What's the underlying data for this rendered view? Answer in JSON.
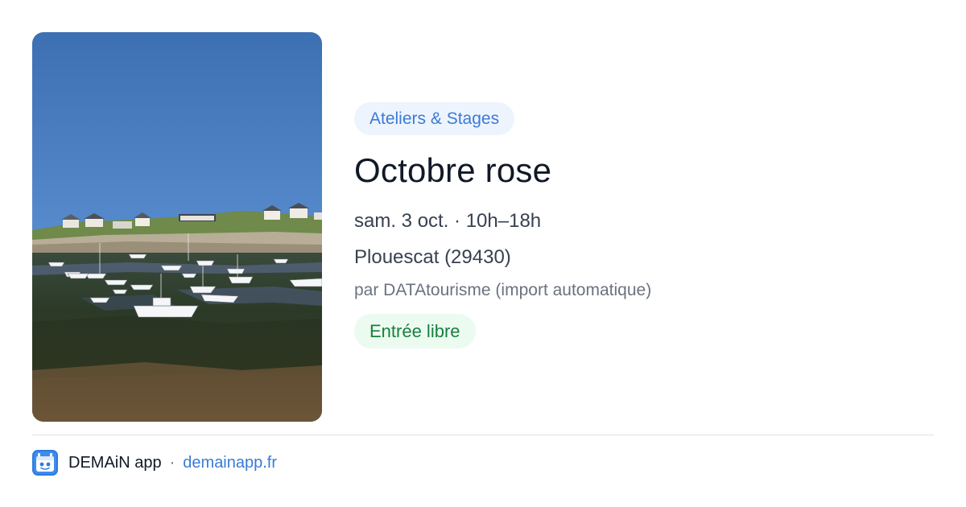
{
  "event": {
    "category": "Ateliers & Stages",
    "title": "Octobre rose",
    "datetime": "sam. 3 oct. · 10h–18h",
    "location": "Plouescat (29430)",
    "source": "par DATAtourisme (import automatique)",
    "price": "Entrée libre",
    "photo_icon": "harbour-photo"
  },
  "footer": {
    "app_name": "DEMAiN app",
    "separator": "·",
    "url": "demainapp.fr",
    "logo_icon": "demain-app-logo-icon"
  },
  "colors": {
    "accent": "#3a7bd5",
    "category_bg": "#eef4fd",
    "price_text": "#17803d",
    "price_bg": "#ecfbf0"
  }
}
